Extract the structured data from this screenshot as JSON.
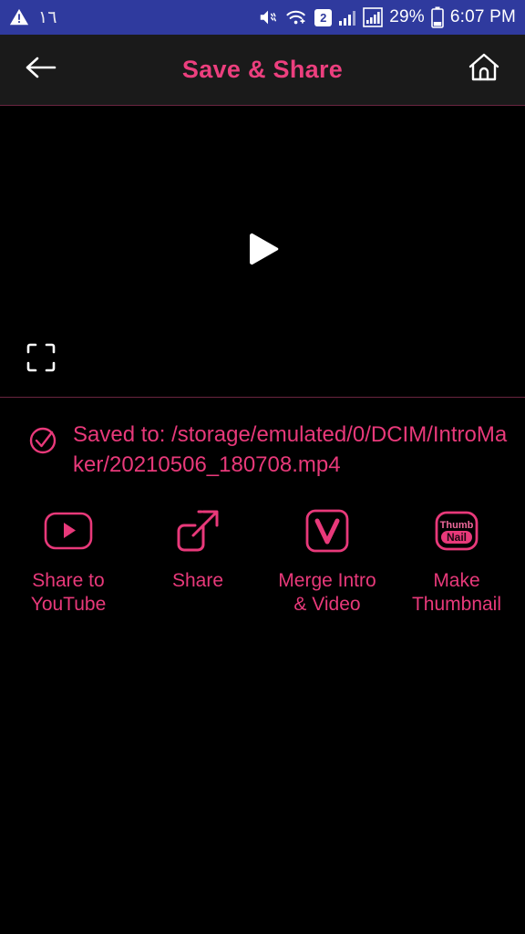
{
  "theme": {
    "accent_pink": "#E8397A",
    "title_pink": "#EC3F7E",
    "statusbar_blue": "#2F3A9E",
    "header_bg": "#1A1A1A",
    "page_bg": "#000000",
    "divider": "#6A2540"
  },
  "statusbar": {
    "left": {
      "warning_icon": "warning-triangle-icon",
      "notification_count": "١٦"
    },
    "right": {
      "mute_icon": "volume-mute-icon",
      "wifi_icon": "wifi-icon",
      "sim_badge": "2",
      "signal_icon_1": "signal-bars-icon",
      "signal_icon_2": "signal-bars-boxed-icon",
      "battery_percent": "29%",
      "battery_icon": "battery-icon",
      "clock": "6:07 PM"
    }
  },
  "header": {
    "back_icon": "back-arrow-icon",
    "title": "Save & Share",
    "home_icon": "home-icon"
  },
  "video": {
    "play_icon": "play-icon",
    "fullscreen_icon": "fullscreen-icon"
  },
  "saved": {
    "check_icon": "check-circle-icon",
    "message": "Saved to: /storage/emulated/0/DCIM/IntroMaker/20210506_180708.mp4"
  },
  "actions": [
    {
      "icon": "youtube-icon",
      "label": "Share to\nYouTube"
    },
    {
      "icon": "share-icon",
      "label": "Share"
    },
    {
      "icon": "merge-video-icon",
      "label": "Merge Intro\n& Video"
    },
    {
      "icon": "thumbnail-icon",
      "label": "Make\nThumbnail",
      "glyph_top": "Thumb",
      "glyph_bottom": "Nail"
    }
  ]
}
